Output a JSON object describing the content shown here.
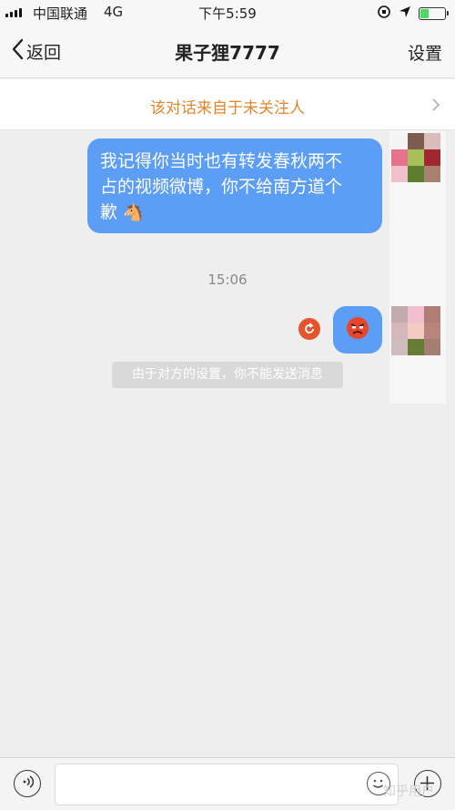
{
  "status_bar": {
    "carrier": "中国联通",
    "network": "4G",
    "time": "下午5:59",
    "battery_level": 0.35
  },
  "nav": {
    "back_label": "返回",
    "title": "果子狸7777",
    "settings_label": "设置"
  },
  "notice": {
    "text": "该对话来自于未关注人"
  },
  "messages": [
    {
      "line1": "我记得你当时也有转发春秋两不",
      "line2": "占的视频微博，你不给南方道个",
      "line3": "歉",
      "emoji": "🐴"
    },
    {
      "emoji": "angry-face"
    }
  ],
  "timestamp": "15:06",
  "system_message": "由于对方的设置，你不能发送消息",
  "input": {
    "placeholder": ""
  },
  "watermark": "知乎用户",
  "colors": {
    "bubble": "#5c9ef5",
    "notice_text": "#e5862a",
    "retry": "#e4552d",
    "background": "#eeeeee"
  }
}
